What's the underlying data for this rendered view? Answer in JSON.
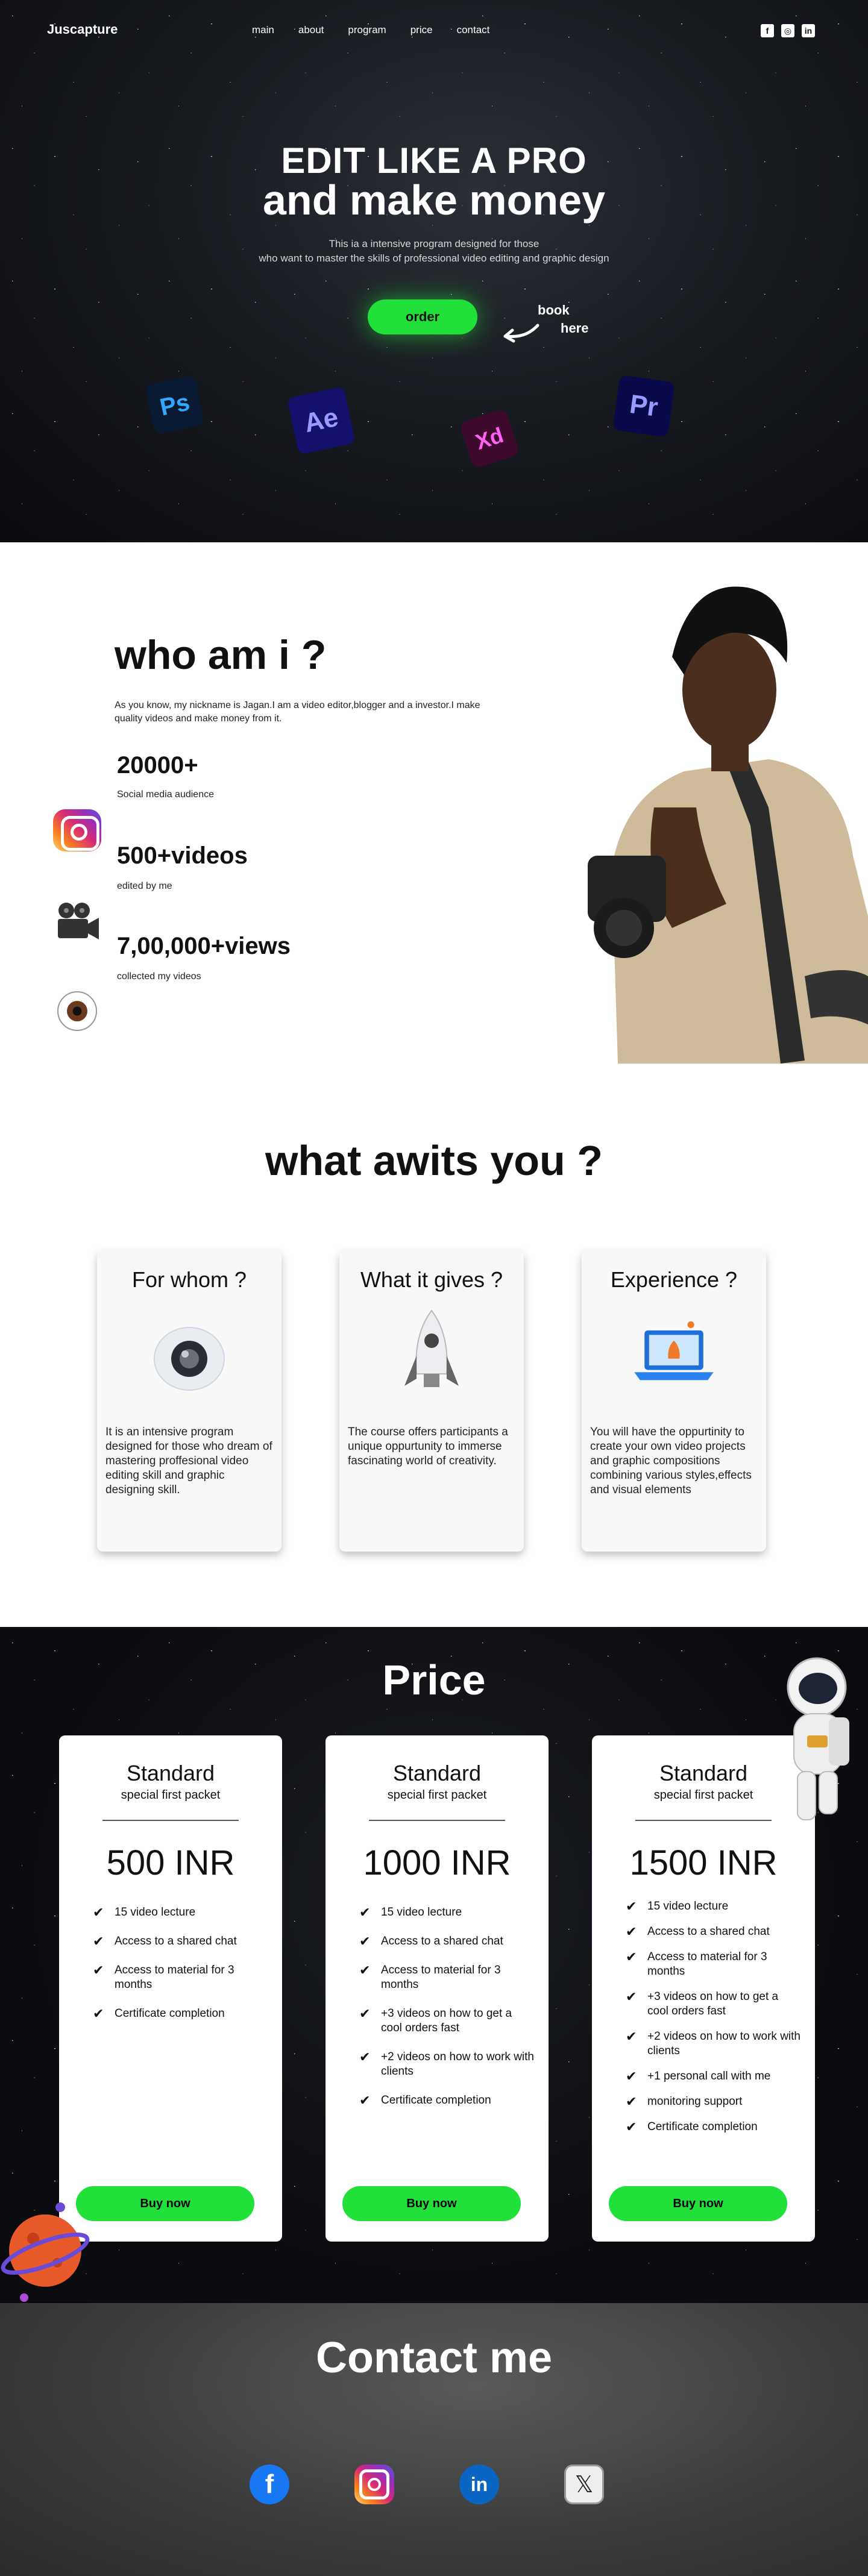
{
  "nav": {
    "logo": "Juscapture",
    "links": [
      "main",
      "about",
      "program",
      "price",
      "contact"
    ],
    "social_icons": [
      "facebook-icon",
      "instagram-icon",
      "linkedin-icon"
    ]
  },
  "hero": {
    "title_line1": "EDIT LIKE A PRO",
    "title_line2": "and make money",
    "subtitle_line1": "This ia a intensive program designed for those",
    "subtitle_line2": "who want to master the skills of professional video editing and graphic design",
    "order_label": "order",
    "book_line1": "book",
    "book_line2": "here",
    "app_icons": [
      "Ps",
      "Ae",
      "Xd",
      "Pr"
    ]
  },
  "about": {
    "title": "who am i ?",
    "description": "As you know, my nickname is Jagan.I am a video editor,blogger and a investor.I make quality videos and make money from it.",
    "stats": [
      {
        "value": "20000+",
        "label": "Social media audience",
        "icon": "instagram-icon"
      },
      {
        "value": "500+videos",
        "label": "edited by me",
        "icon": "camera-icon"
      },
      {
        "value": "7,00,000+views",
        "label": "collected my videos",
        "icon": "eye-icon"
      }
    ]
  },
  "awaits": {
    "title": "what awits you ?",
    "cards": [
      {
        "title": "For whom ?",
        "icon": "webcam-icon",
        "text": "It is an intensive program designed for those who dream of mastering proffesional video editing skill and graphic designing skill."
      },
      {
        "title": "What it gives ?",
        "icon": "rocket-icon",
        "text": "The course offers participants a unique oppurtunity to immerse fascinating world of creativity."
      },
      {
        "title": "Experience ?",
        "icon": "laptop-icon",
        "text": "You will have the oppurtinity to create your own video projects and graphic compositions combining various styles,effects and visual elements"
      }
    ]
  },
  "pricing": {
    "title": "Price",
    "plans": [
      {
        "name": "Standard",
        "sub": "special first packet",
        "price": "500 INR",
        "features": [
          "15 video lecture",
          "Access to a shared chat",
          "Access to material for 3 months",
          "Certificate completion"
        ],
        "button": "Buy now"
      },
      {
        "name": "Standard",
        "sub": "special first packet",
        "price": "1000 INR",
        "features": [
          "15 video lecture",
          "Access to a shared chat",
          "Access to material for 3 months",
          "+3 videos on how to get a cool orders fast",
          "+2 videos on how to work with clients",
          "Certificate completion"
        ],
        "button": "Buy now"
      },
      {
        "name": "Standard",
        "sub": "special first packet",
        "price": "1500 INR",
        "features": [
          "15 video lecture",
          "Access to a shared chat",
          "Access to material for 3 months",
          "+3 videos on how to get a cool orders fast",
          "+2 videos on how to work with clients",
          "+1 personal call with me",
          "monitoring support",
          "Certificate completion"
        ],
        "button": "Buy now"
      }
    ]
  },
  "contact": {
    "title": "Contact me",
    "socials": [
      "facebook-icon",
      "instagram-icon",
      "linkedin-icon",
      "x-icon"
    ]
  },
  "colors": {
    "accent_green": "#22e03a",
    "dark_bg": "#0b0c0f"
  }
}
